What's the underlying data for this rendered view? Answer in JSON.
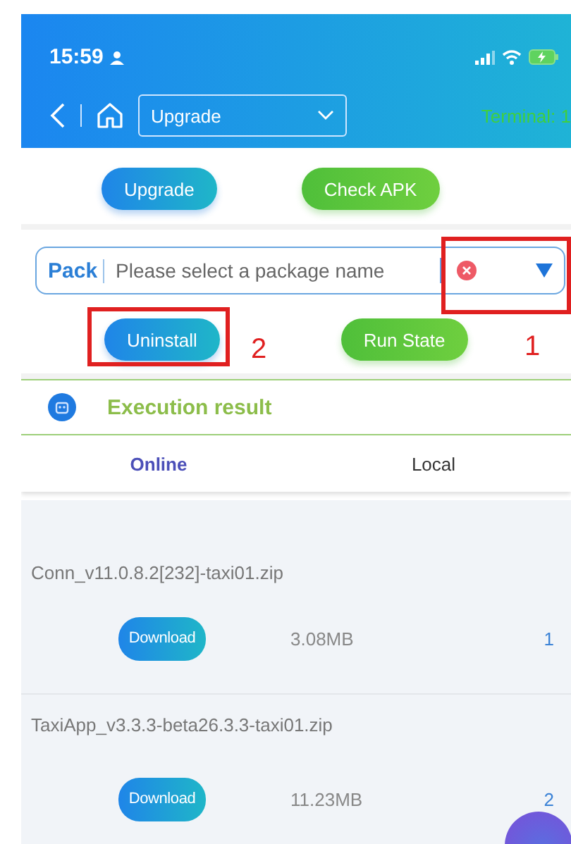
{
  "status_bar": {
    "time": "15:59"
  },
  "nav": {
    "dropdown": "Upgrade",
    "terminal": "Terminal:  1"
  },
  "actions_top": [
    {
      "label": "Upgrade",
      "kind": "blue"
    },
    {
      "label": "Check APK",
      "kind": "green"
    }
  ],
  "pack_field": {
    "label": "Pack",
    "placeholder": "Please select a package name"
  },
  "actions_bottom": [
    {
      "label": "Uninstall",
      "kind": "blue"
    },
    {
      "label": "Run State",
      "kind": "green"
    }
  ],
  "annotations": [
    "2",
    "1"
  ],
  "result_panel": {
    "title": "Execution result"
  },
  "tabs": [
    {
      "label": "Online",
      "selected": true
    },
    {
      "label": "Local",
      "selected": false
    }
  ],
  "files": [
    {
      "name": "Conn_v11.0.8.2[232]-taxi01.zip",
      "button": "Download",
      "size": "3.08MB",
      "index": "1"
    },
    {
      "name": "TaxiApp_v3.3.3-beta26.3.3-taxi01.zip",
      "button": "Download",
      "size": "11.23MB",
      "index": "2"
    }
  ]
}
